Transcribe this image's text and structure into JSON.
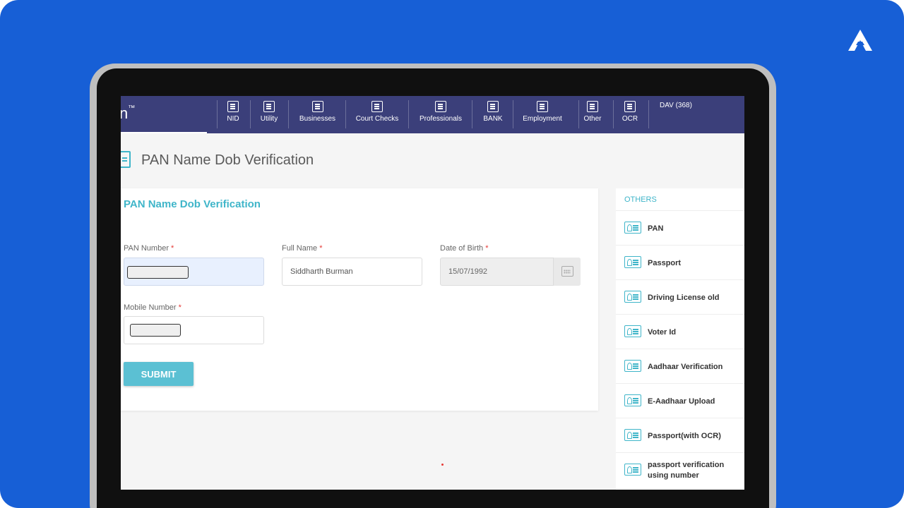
{
  "colors": {
    "background": "#175fd6",
    "nav": "#3b3f7a",
    "accent": "#3fb5c9",
    "button": "#5bc0d3",
    "required": "#e53935"
  },
  "brand": {
    "icon": "brand-logo-icon"
  },
  "app": {
    "logo_text": "n",
    "logo_tm": "™"
  },
  "nav": {
    "items": [
      {
        "label": "NID",
        "icon": "id-card-icon"
      },
      {
        "label": "Utility",
        "icon": "document-icon"
      },
      {
        "label": "Businesses",
        "icon": "document-icon"
      },
      {
        "label": "Court Checks",
        "icon": "court-icon"
      },
      {
        "label": "Professionals",
        "icon": "document-icon"
      },
      {
        "label": "BANK",
        "icon": "document-icon"
      },
      {
        "label": "Employment",
        "icon": "document-icon"
      },
      {
        "label": "Other",
        "icon": "id-card-icon"
      },
      {
        "label": "OCR",
        "icon": "ocr-icon"
      }
    ],
    "user": "DAV (368)"
  },
  "page": {
    "title": "PAN Name Dob Verification"
  },
  "form": {
    "title": "PAN Name Dob Verification",
    "required_mark": "*",
    "pan": {
      "label": "PAN Number",
      "value": ""
    },
    "name": {
      "label": "Full Name",
      "value": "Siddharth Burman"
    },
    "dob": {
      "label": "Date of Birth",
      "value": "15/07/1992"
    },
    "mobile": {
      "label": "Mobile Number",
      "value": ""
    },
    "submit_label": "SUBMIT"
  },
  "sidebar": {
    "heading": "OTHERS",
    "items": [
      {
        "label": "PAN"
      },
      {
        "label": "Passport"
      },
      {
        "label": "Driving License old"
      },
      {
        "label": "Voter Id"
      },
      {
        "label": "Aadhaar Verification"
      },
      {
        "label": "E-Aadhaar Upload"
      },
      {
        "label": "Passport(with OCR)"
      },
      {
        "label": "passport verification using number"
      }
    ]
  }
}
